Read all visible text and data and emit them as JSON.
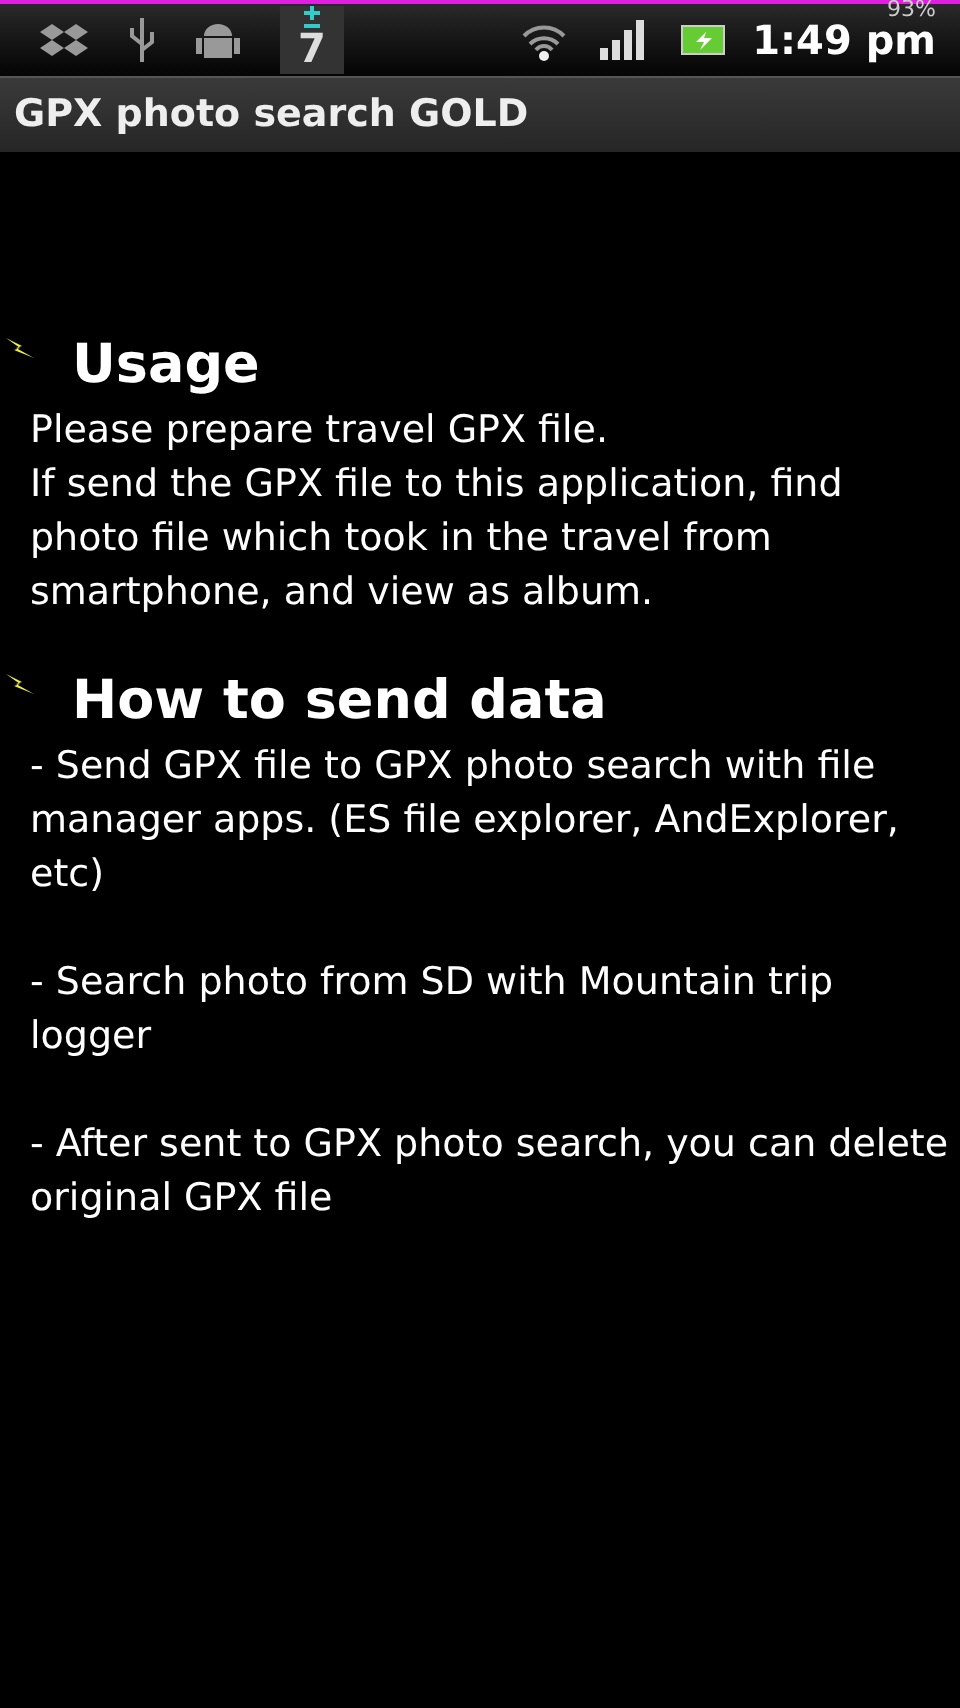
{
  "status_bar": {
    "notification_count": "7",
    "battery": "93%",
    "time": "1:49 pm"
  },
  "title_bar": {
    "title": "GPX photo search GOLD"
  },
  "sections": [
    {
      "heading": "Usage",
      "paragraphs": [
        "Please prepare travel GPX file.",
        "If send the GPX file to this application, find photo file which took in the travel from smartphone, and view as album."
      ]
    },
    {
      "heading": "How to send data",
      "paragraphs": [
        "- Send GPX file to GPX photo search with file manager apps. (ES file explorer, AndExplorer, etc)",
        "- Search photo from SD with Mountain trip logger",
        "- After sent to GPX photo search, you can delete original GPX file"
      ]
    }
  ]
}
